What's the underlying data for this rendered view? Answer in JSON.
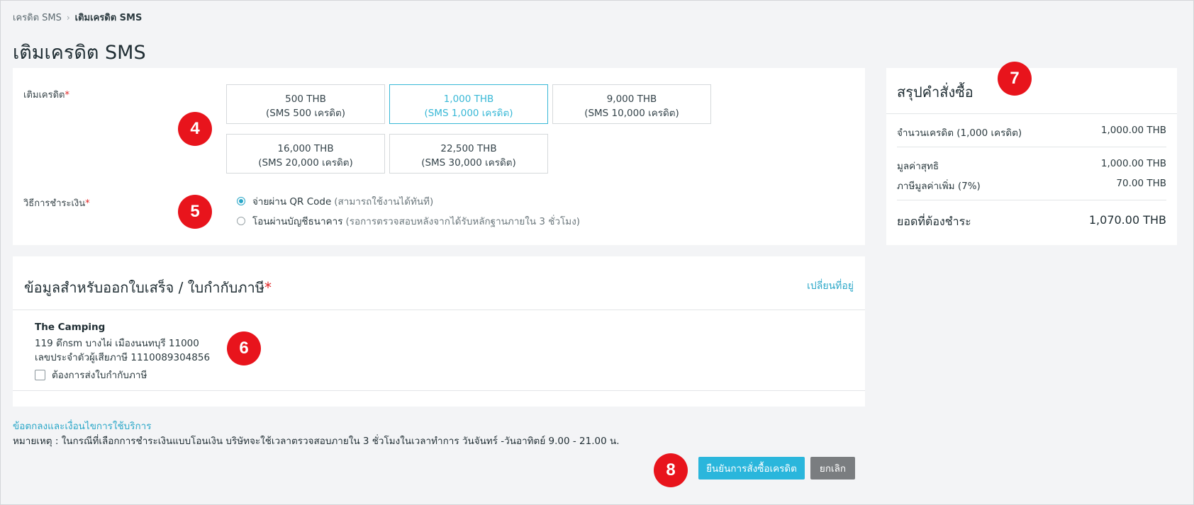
{
  "breadcrumb": {
    "parent": "เครดิต SMS",
    "separator": "›",
    "current": "เติมเครดิต SMS"
  },
  "page_title": "เติมเครดิต SMS",
  "credit_section": {
    "label": "เติมเครดิต",
    "required_mark": "*",
    "packages": [
      {
        "price": "500 THB",
        "sub": "(SMS 500 เครดิต)",
        "selected": false
      },
      {
        "price": "1,000 THB",
        "sub": "(SMS 1,000 เครดิต)",
        "selected": true
      },
      {
        "price": "9,000 THB",
        "sub": "(SMS 10,000 เครดิต)",
        "selected": false
      },
      {
        "price": "16,000 THB",
        "sub": "(SMS 20,000 เครดิต)",
        "selected": false
      },
      {
        "price": "22,500 THB",
        "sub": "(SMS 30,000 เครดิต)",
        "selected": false
      }
    ]
  },
  "payment_section": {
    "label": "วิธีการชำระเงิน",
    "required_mark": "*",
    "options": [
      {
        "label": "จ่ายผ่าน QR Code",
        "note": "(สามารถใช้งานได้ทันที)",
        "checked": true
      },
      {
        "label": "โอนผ่านบัญชีธนาคาร",
        "note": "(รอการตรวจสอบหลังจากได้รับหลักฐานภายใน 3 ชั่วโมง)",
        "checked": false
      }
    ]
  },
  "invoice_section": {
    "title": "ข้อมูลสำหรับออกใบเสร็จ / ใบกำกับภาษี",
    "required_mark": "*",
    "change_address": "เปลี่ยนที่อยู่",
    "company_name": "The Camping",
    "address": "119 ตึกsm บางไผ่ เมืองนนทบุรี 11000",
    "tax_id": "เลขประจำตัวผู้เสียภาษี 1110089304856",
    "send_invoice_label": "ต้องการส่งใบกำกับภาษี",
    "send_invoice_checked": false
  },
  "summary": {
    "title": "สรุปคำสั่งซื้อ",
    "credit_amount_label": "จำนวนเครดิต (1,000 เครดิต)",
    "credit_amount_value": "1,000.00 THB",
    "net_label": "มูลค่าสุทธิ",
    "net_value": "1,000.00 THB",
    "vat_label": "ภาษีมูลค่าเพิ่ม (7%)",
    "vat_value": "70.00 THB",
    "total_label": "ยอดที่ต้องชำระ",
    "total_value": "1,070.00 THB"
  },
  "footer": {
    "terms_link": "ข้อตกลงและเงื่อนไขการใช้บริการ",
    "note": "หมายเหตุ : ในกรณีที่เลือกการชำระเงินแบบโอนเงิน บริษัทจะใช้เวลาตรวจสอบภายใน 3 ชั่วโมงในเวลาทำการ วันจันทร์ -วันอาทิตย์ 9.00 - 21.00 น.",
    "confirm_button": "ยืนยันการสั่งซื้อเครดิต",
    "cancel_button": "ยกเลิก"
  },
  "annotations": {
    "badge_4": "4",
    "badge_5": "5",
    "badge_6": "6",
    "badge_7": "7",
    "badge_8": "8"
  },
  "colors": {
    "accent": "#2aa7c8",
    "selected_border": "#38b8d6",
    "required": "#e02424",
    "badge": "#e8141c",
    "confirm_button": "#2ab6dc",
    "cancel_button": "#7a7d80",
    "background": "#f3f4f6"
  }
}
